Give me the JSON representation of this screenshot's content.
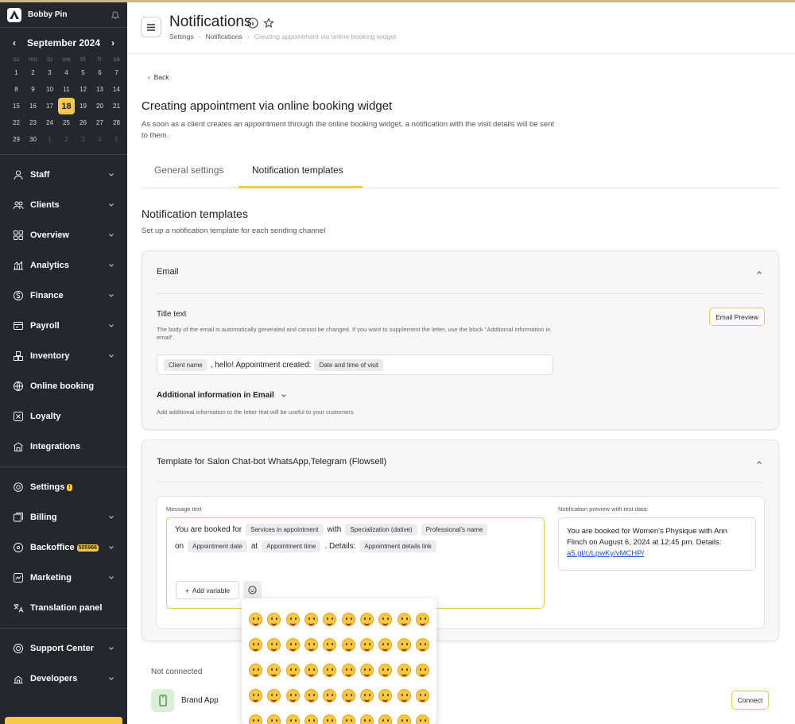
{
  "sidebar": {
    "user_name": "Bobby Pin",
    "calendar": {
      "month_label": "September 2024",
      "weekdays": [
        "su",
        "mo",
        "tu",
        "we",
        "th",
        "fr",
        "sa"
      ],
      "rows": [
        [
          "1",
          "2",
          "3",
          "4",
          "5",
          "6",
          "7"
        ],
        [
          "8",
          "9",
          "10",
          "11",
          "12",
          "13",
          "14"
        ],
        [
          "15",
          "16",
          "17",
          "18",
          "19",
          "20",
          "21"
        ],
        [
          "22",
          "23",
          "24",
          "25",
          "26",
          "27",
          "28"
        ],
        [
          "29",
          "30",
          "1",
          "2",
          "3",
          "4",
          "5"
        ]
      ],
      "today": "18"
    },
    "nav": [
      {
        "label": "Staff",
        "icon": "person-icon"
      },
      {
        "label": "Clients",
        "icon": "clients-icon"
      },
      {
        "label": "Overview",
        "icon": "grid-icon"
      },
      {
        "label": "Analytics",
        "icon": "analytics-icon"
      },
      {
        "label": "Finance",
        "icon": "dollar-icon"
      },
      {
        "label": "Payroll",
        "icon": "payroll-icon"
      },
      {
        "label": "Inventory",
        "icon": "inventory-icon"
      },
      {
        "label": "Online booking",
        "icon": "globe-icon"
      },
      {
        "label": "Loyalty",
        "icon": "loyalty-icon"
      },
      {
        "label": "Integrations",
        "icon": "integrations-icon"
      }
    ],
    "nav2": [
      {
        "label": "Settings",
        "icon": "gear-icon",
        "badge": "!"
      },
      {
        "label": "Billing",
        "icon": "billing-icon"
      },
      {
        "label": "Backoffice",
        "icon": "backoffice-icon",
        "badge": "505966"
      },
      {
        "label": "Marketing",
        "icon": "marketing-icon"
      },
      {
        "label": "Translation panel",
        "icon": "translate-icon"
      }
    ],
    "nav3": [
      {
        "label": "Support Center",
        "icon": "support-icon"
      },
      {
        "label": "Developers",
        "icon": "developers-icon"
      }
    ]
  },
  "header": {
    "title": "Notifications",
    "breadcrumbs": [
      "Settings",
      "Notifications",
      "Creating appointment via online booking widget"
    ]
  },
  "main": {
    "back_label": "Back",
    "heading": "Creating appointment via online booking widget",
    "description": "As soon as a client creates an appointment through the online booking widget, a notification with the visit details will be sent to them.",
    "tabs": [
      {
        "label": "General settings",
        "active": false
      },
      {
        "label": "Notification templates",
        "active": true
      }
    ],
    "section_title": "Notification templates",
    "section_subtitle": "Set up a notification template for each sending channel",
    "email_card": {
      "title": "Email",
      "title_text_label": "Title text",
      "preview_button": "Email Preview",
      "note": "The body of the email is automatically generated and cannot be changed. If you want to supplement the letter, use the block \"Additional information in email\".",
      "chip1": "Client name",
      "text1": ", hello! Appointment created:",
      "chip2": "Date and time of visit",
      "additional_label": "Additional information in Email",
      "additional_note": "Add additional information to the letter that will be useful to your customers"
    },
    "chatbot_card": {
      "title": "Template for Salon Chat-bot WhatsApp,Telegram (Flowsell)",
      "message_label": "Message text",
      "line1": {
        "t1": "You are booked for",
        "c1": "Services in appointment",
        "t2": "with",
        "c2": "Specialization (dative)",
        "c3": "Professional's name"
      },
      "line2": {
        "t1": "on",
        "c1": "Appointment date",
        "t2": "at",
        "c2": "Appointment time",
        "t3": ". Details:",
        "c3": "Appointment details link"
      },
      "add_variable": "Add variable",
      "preview_label": "Notification preview with test data:",
      "preview_text": "You are booked for Women's Physique with Ann Flinch on August 6, 2024 at 12:45 pm. Details:",
      "preview_link": "a5.gl/c/LpwKy/vMCHP/"
    },
    "not_connected_label": "Not connected",
    "brand_app": {
      "name": "Brand App",
      "button": "Connect"
    }
  },
  "emoji_picker": {
    "count": 50
  },
  "colors": {
    "accent": "#f5c84a",
    "sidebar_bg": "#24282c",
    "link": "#1a4fd6"
  }
}
